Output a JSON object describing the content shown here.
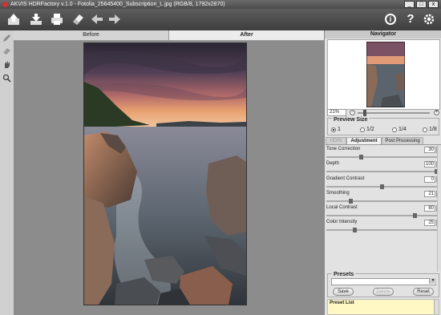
{
  "window": {
    "title": "AKVIS HDRFactory v.1.0 - Fotolia_25645400_Subscription_L.jpg (RGB/8, 1792x2870)",
    "minimize": "_",
    "maximize": "□",
    "close": "x"
  },
  "toolbar": {
    "icons": [
      "open-icon",
      "save-icon",
      "print-icon",
      "eraser-icon",
      "undo-icon",
      "redo-icon",
      "info-icon",
      "help-icon",
      "settings-icon"
    ],
    "help_glyph": "?",
    "info_glyph": "i"
  },
  "left_tools": [
    "pencil-icon",
    "eraser-tool-icon",
    "hand-icon",
    "zoom-icon"
  ],
  "view": {
    "tab_before": "Before",
    "tab_after": "After"
  },
  "navigator": {
    "title": "Navigator",
    "zoom_value": "21%",
    "zoom_minus": "-",
    "zoom_plus": "+",
    "zoom_level": 0.08
  },
  "preview_size": {
    "title": "Preview Size",
    "options": [
      "1",
      "1/2",
      "1/4",
      "1/8"
    ],
    "selected_index": 0
  },
  "panel_tabs": [
    "HDRI",
    "Adjustment",
    "Post Processing"
  ],
  "active_panel_tab": "Adjustment",
  "params": [
    {
      "label": "Tone Correction",
      "value": "30",
      "fraction": 0.31
    },
    {
      "label": "Depth",
      "value": "100",
      "fraction": 1.0
    },
    {
      "label": "Gradient Contrast",
      "value": "0",
      "fraction": 0.5
    },
    {
      "label": "Smoothing",
      "value": "21",
      "fraction": 0.21
    },
    {
      "label": "Local Contrast",
      "value": "80",
      "fraction": 0.8
    },
    {
      "label": "Color Intensity",
      "value": "25",
      "fraction": 0.25
    }
  ],
  "presets": {
    "title": "Presets",
    "selected": "",
    "save": "Save",
    "delete": "Delete",
    "reset": "Reset",
    "list_label": "Preset List"
  },
  "colors": {
    "toolbar": "#4a4a4a",
    "panel": "#e2e2e2",
    "view_bg": "#8c8c8c",
    "preset_list_bg": "#fff8c4"
  }
}
